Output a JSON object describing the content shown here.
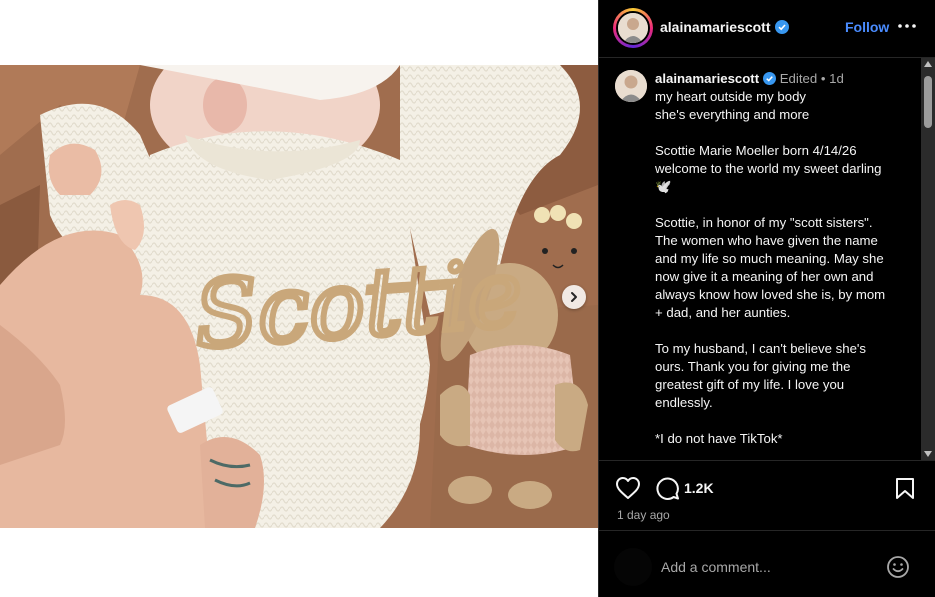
{
  "post": {
    "username": "alainamariescott",
    "follow_label": "Follow",
    "edited_label": "Edited",
    "separator": "•",
    "caption_age": "1d",
    "caption_lines": [
      "my heart outside my body",
      "she's everything and more",
      "",
      "Scottie Marie Moeller born 4/14/26",
      "welcome to the world my sweet darling",
      "🕊️",
      "",
      "Scottie, in honor of my \"scott sisters\".",
      "The women who have given the name",
      "and my life so much meaning. May she",
      "now give it a meaning of her own and",
      "always know how loved she is, by mom",
      "+ dad, and her aunties.",
      "",
      "To my husband, I can't believe she's",
      "ours. Thank you for giving me the",
      "greatest gift of my life. I love you",
      "endlessly.",
      "",
      "*I do not have TikTok*"
    ],
    "comment_count": "1.2K",
    "time_ago": "1 day ago",
    "comment_placeholder": "Add a comment...",
    "sweater_text": "Scottie",
    "icons": {
      "verified": "verified-badge-icon",
      "more": "more-options-icon",
      "like": "heart-icon",
      "comment": "comment-bubble-icon",
      "save": "bookmark-icon",
      "emoji": "emoji-icon",
      "next": "chevron-right-icon"
    },
    "colors": {
      "panel_bg": "#000000",
      "link_blue": "#4a8cff",
      "verified_blue": "#3897f0",
      "muted": "#a8a8a8",
      "sweater_embroidery": "#c9a77a"
    }
  }
}
